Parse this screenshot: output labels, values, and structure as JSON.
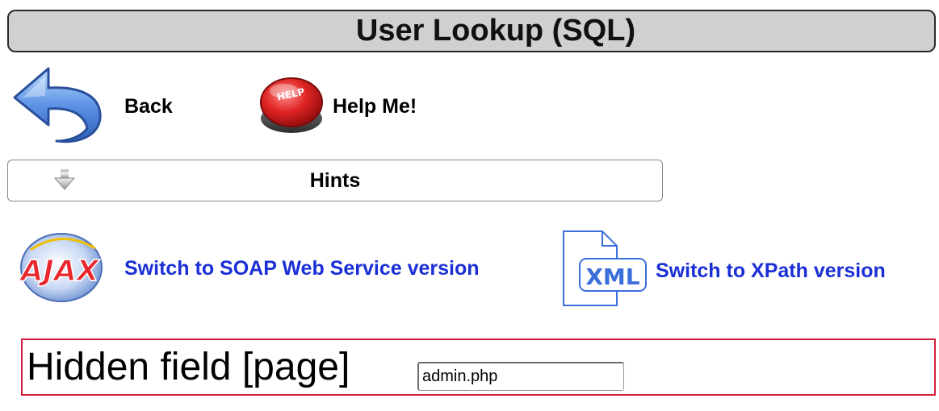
{
  "header": {
    "title": "User Lookup (SQL)"
  },
  "nav": {
    "back_label": "Back",
    "help_label": "Help Me!",
    "help_button_text": "HELP"
  },
  "hints": {
    "label": "Hints"
  },
  "switches": {
    "ajax_logo_text": "AJAX",
    "soap_label": "Switch to SOAP Web Service version",
    "xml_icon_text": "XML",
    "xpath_label": "Switch to XPath version"
  },
  "hidden_field": {
    "label": "Hidden field [page]",
    "value": "admin.php"
  },
  "colors": {
    "title_bg": "#d0d0d0",
    "link_blue": "#1a2fd6",
    "highlight_red": "#d21f3c",
    "back_arrow_blue": "#4a7fd8",
    "help_red": "#d42020",
    "xml_blue": "#3b6fd9"
  }
}
